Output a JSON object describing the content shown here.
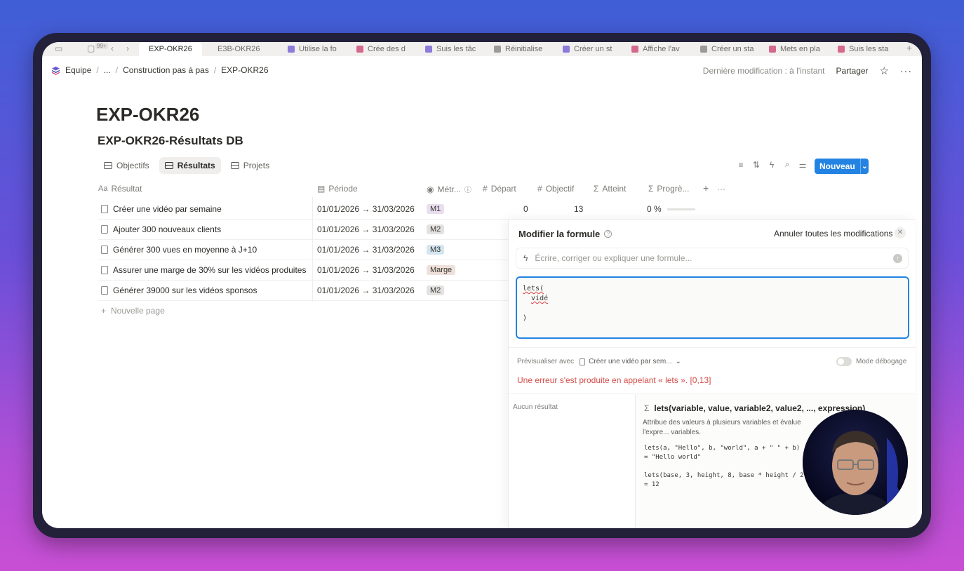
{
  "tabs": {
    "badge": "99+",
    "active": "EXP-OKR26",
    "items": [
      "E3B-OKR26",
      "Utilise la fo",
      "Crée des d",
      "Suis les tâc",
      "Réinitialise",
      "Créer un st",
      "Affiche l'av",
      "Créer un sta",
      "Mets en pla",
      "Suis les sta"
    ]
  },
  "breadcrumb": {
    "workspace": "Equipe",
    "ellipsis": "...",
    "parent": "Construction pas à pas",
    "current": "EXP-OKR26"
  },
  "topbar": {
    "last_modified": "Dernière modification : à l'instant",
    "share": "Partager"
  },
  "page": {
    "title": "EXP-OKR26",
    "db_title": "EXP-OKR26-Résultats DB"
  },
  "views": [
    "Objectifs",
    "Résultats",
    "Projets"
  ],
  "toolbar": {
    "new_label": "Nouveau"
  },
  "columns": {
    "name": "Résultat",
    "period": "Période",
    "metric": "Métr...",
    "start": "Départ",
    "target": "Objectif",
    "achieved": "Atteint",
    "progress": "Progrè..."
  },
  "rows": [
    {
      "name": "Créer une vidéo par semaine",
      "period": "01/01/2026 → 31/03/2026",
      "metric": "M1",
      "metric_color": "#e8deee",
      "start": "0",
      "target": "13",
      "progress": "0 %"
    },
    {
      "name": "Ajouter 300 nouveaux clients",
      "period": "01/01/2026 → 31/03/2026",
      "metric": "M2",
      "metric_color": "#e3e2e0"
    },
    {
      "name": "Générer 300 vues en moyenne à J+10",
      "period": "01/01/2026 → 31/03/2026",
      "metric": "M3",
      "metric_color": "#d3e5ef"
    },
    {
      "name": "Assurer une marge de 30% sur les vidéos produites",
      "period": "01/01/2026 → 31/03/2026",
      "metric": "Marge",
      "metric_color": "#eee0da"
    },
    {
      "name": "Générer 39000 sur les vidéos sponsos",
      "period": "01/01/2026 → 31/03/2026",
      "metric": "M2",
      "metric_color": "#e3e2e0"
    }
  ],
  "new_page": "Nouvelle page",
  "formula_panel": {
    "title": "Modifier la formule",
    "cancel_all": "Annuler toutes les modifications",
    "ai_placeholder": "Écrire, corriger ou expliquer une formule...",
    "code_line1": "lets(",
    "code_line2": "vidé",
    "code_line3": ")",
    "preview_label": "Prévisualiser avec",
    "preview_value": "Créer une vidéo par sem...",
    "debug_label": "Mode débogage",
    "error": "Une erreur s'est produite en appelant « lets ». [0,13]",
    "no_result": "Aucun résultat",
    "signature": "lets(variable, value, variable2, value2, ..., expression)",
    "description": "Attribue des valeurs à plusieurs variables et évalue l'expre... variables.",
    "ex1_code": "lets(a, \"Hello\", b, \"world\", a + \" \" + b)",
    "ex1_result": "= \"Hello world\"",
    "ex2_code": "lets(base, 3, height, 8, base * height / 2)",
    "ex2_result": "= 12"
  }
}
